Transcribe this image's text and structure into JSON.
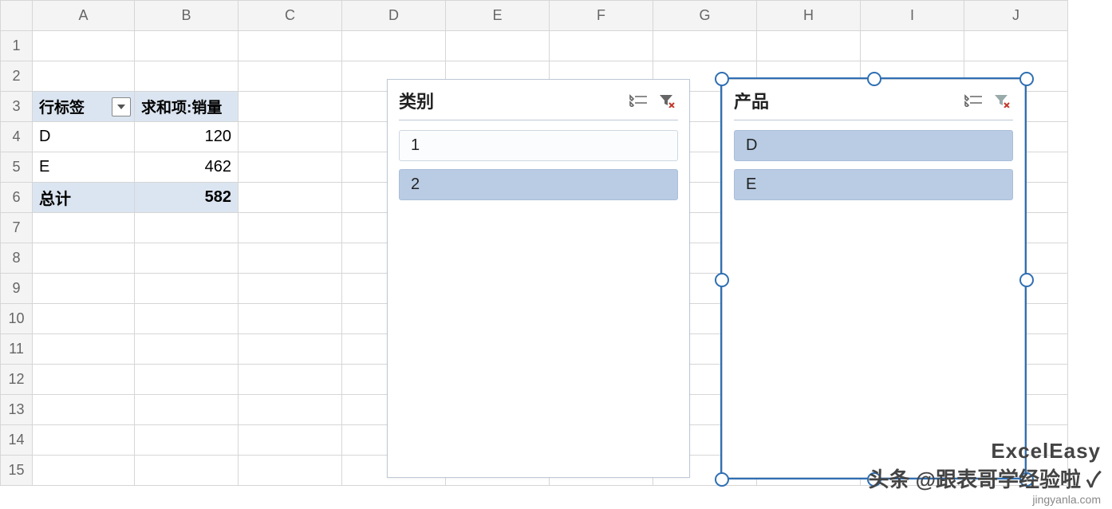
{
  "columns": [
    "A",
    "B",
    "C",
    "D",
    "E",
    "F",
    "G",
    "H",
    "I",
    "J"
  ],
  "row_count": 15,
  "pivot": {
    "rowlabel_header": "行标签",
    "value_header": "求和项:销量",
    "rows": [
      {
        "label": "D",
        "value": "120"
      },
      {
        "label": "E",
        "value": "462"
      }
    ],
    "total_label": "总计",
    "total_value": "582"
  },
  "slicers": {
    "category": {
      "title": "类别",
      "items": [
        {
          "label": "1",
          "selected": false
        },
        {
          "label": "2",
          "selected": true
        }
      ]
    },
    "product": {
      "title": "产品",
      "items": [
        {
          "label": "D",
          "selected": true
        },
        {
          "label": "E",
          "selected": true
        }
      ]
    }
  },
  "watermark": {
    "brand": "ExcelEasy",
    "line": "头条 @跟表哥学经验啦 ✓",
    "url": "jingyanla.com"
  }
}
